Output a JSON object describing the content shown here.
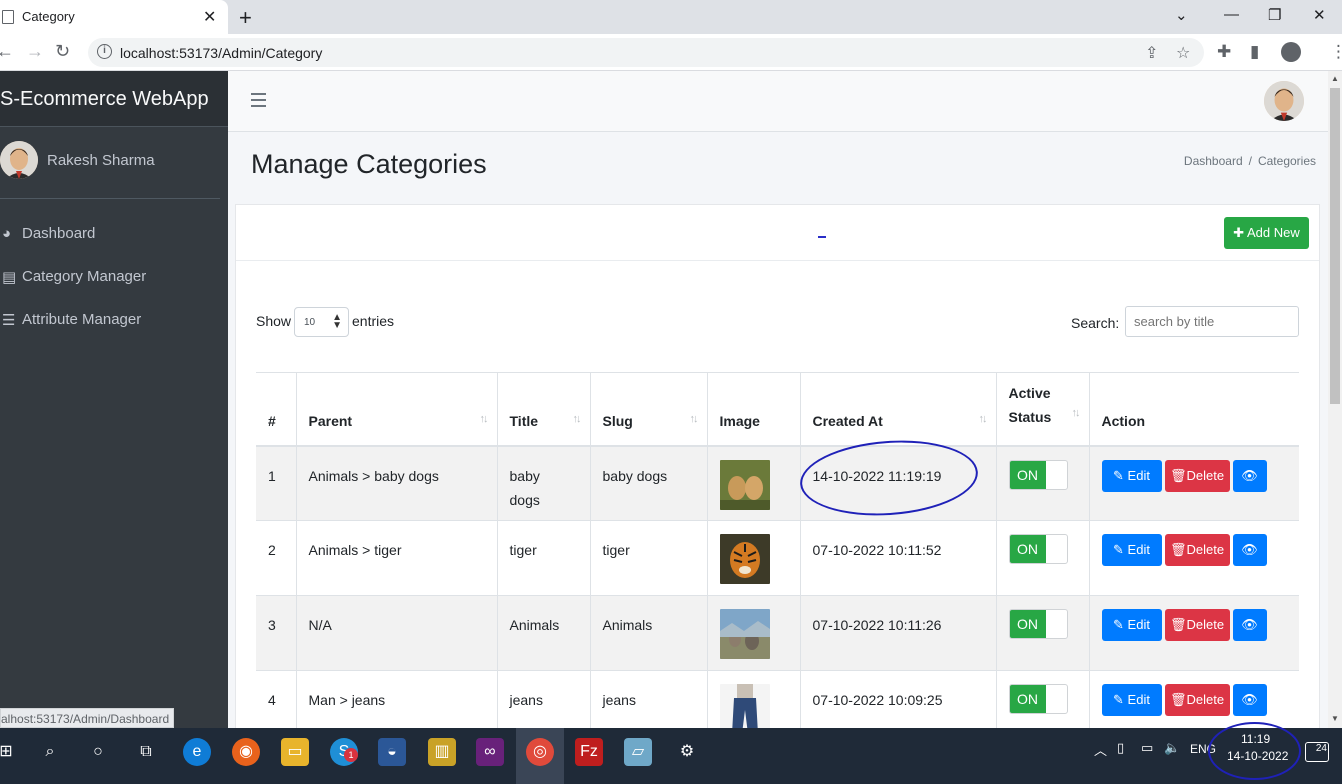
{
  "browser": {
    "tab_title": "Category",
    "url": "localhost:53173/Admin/Category",
    "status_url": "alhost:53173/Admin/Dashboard"
  },
  "sidebar": {
    "brand": "S-Ecommerce WebApp",
    "user_name": "Rakesh Sharma",
    "items": [
      {
        "label": "Dashboard",
        "icon": "tachometer-icon"
      },
      {
        "label": "Category Manager",
        "icon": "list-alt-icon"
      },
      {
        "label": "Attribute Manager",
        "icon": "list-icon"
      }
    ]
  },
  "page": {
    "title": "Manage Categories",
    "breadcrumb": [
      "Dashboard",
      "Categories"
    ],
    "add_button": "Add New",
    "show_label": "Show",
    "entries_value": "10",
    "entries_label": "entries",
    "search_label": "Search:",
    "search_placeholder": "search by title"
  },
  "table": {
    "headers": [
      "#",
      "Parent",
      "Title",
      "Slug",
      "Image",
      "Created At",
      "Active Status",
      "Action"
    ],
    "rows": [
      {
        "num": "1",
        "parent": "Animals > baby dogs",
        "title": "baby dogs",
        "slug": "baby dogs",
        "created": "14-10-2022 11:19:19",
        "status": "ON"
      },
      {
        "num": "2",
        "parent": "Animals > tiger",
        "title": "tiger",
        "slug": "tiger",
        "created": "07-10-2022 10:11:52",
        "status": "ON"
      },
      {
        "num": "3",
        "parent": "N/A",
        "title": "Animals",
        "slug": "Animals",
        "created": "07-10-2022 10:11:26",
        "status": "ON"
      },
      {
        "num": "4",
        "parent": "Man > jeans",
        "title": "jeans",
        "slug": "jeans",
        "created": "07-10-2022 10:09:25",
        "status": "ON"
      }
    ],
    "edit_label": "Edit",
    "delete_label": "Delete"
  },
  "taskbar": {
    "time": "11:19",
    "date": "14-10-2022",
    "lang": "ENG",
    "notifications": "24",
    "skype_badge": "1"
  },
  "colors": {
    "sidebar": "#343a40",
    "success": "#28a745",
    "primary": "#007bff",
    "danger": "#dc3545",
    "annotation": "#1f21b8"
  }
}
